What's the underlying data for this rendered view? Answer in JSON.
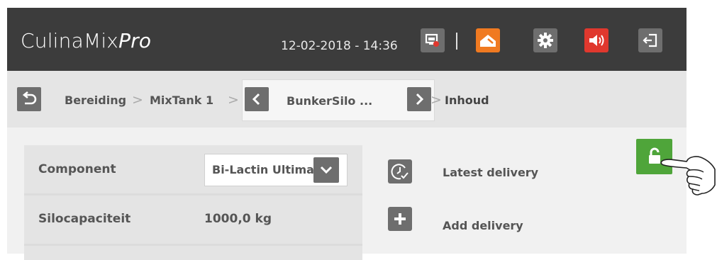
{
  "header": {
    "app_name": "CulinaMix",
    "app_name_suffix": "Pro",
    "datetime": "12-02-2018 - 14:36",
    "buttons": [
      {
        "icon": "monitor-alert-icon",
        "color": "#6e6e6e"
      },
      {
        "icon": "home-icon",
        "color": "#f07a21"
      },
      {
        "icon": "gear-icon",
        "color": "#6e6e6e"
      },
      {
        "icon": "speaker-icon",
        "color": "#e0382e"
      },
      {
        "icon": "logout-icon",
        "color": "#6e6e6e"
      }
    ]
  },
  "breadcrumb": {
    "items": [
      "Bereiding",
      "MixTank 1",
      "BunkerSilo ...",
      "Inhoud"
    ],
    "separator": ">"
  },
  "table": {
    "rows": [
      {
        "label": "Component",
        "value": "Bi-Lactin Ultimate"
      },
      {
        "label": "Silocapaciteit",
        "value": "1000,0 kg"
      }
    ]
  },
  "actions": [
    {
      "label": "Latest delivery",
      "icon": "clock-check-icon"
    },
    {
      "label": "Add delivery",
      "icon": "plus-icon"
    }
  ],
  "lock": {
    "icon": "unlock-icon",
    "color": "#4fa53a"
  }
}
